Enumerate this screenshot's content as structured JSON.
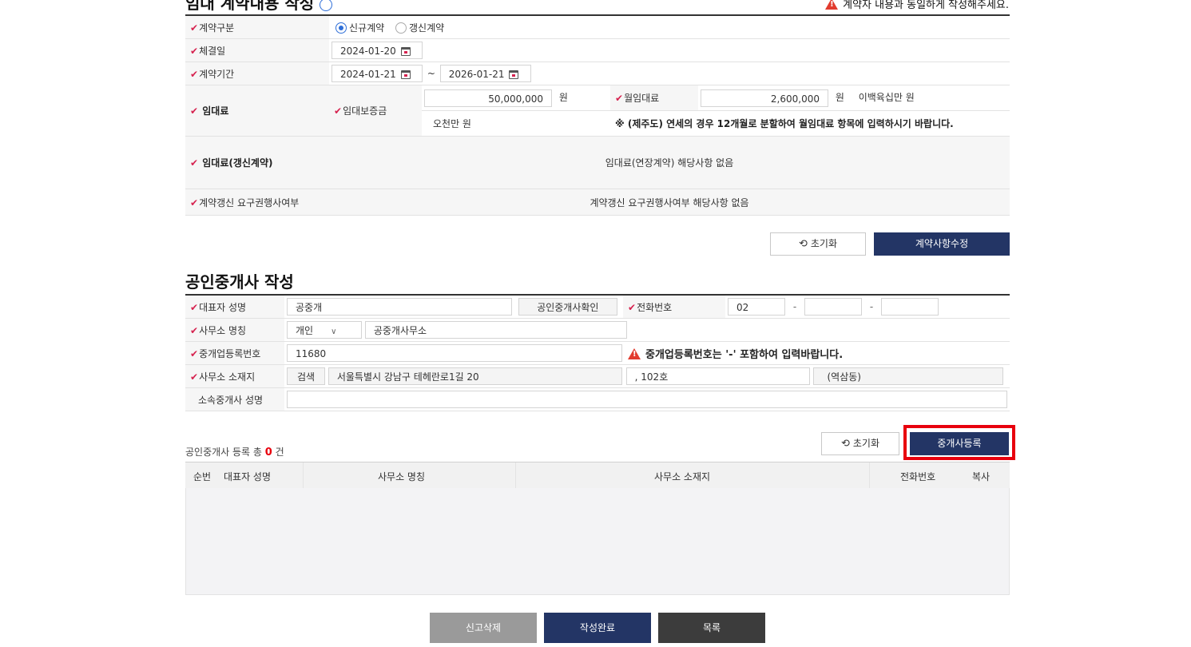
{
  "section1": {
    "title": "임대 계약내용 작성",
    "help_icon": "question-circle-icon",
    "notice": "계약자 내용과 동일하게 작성해주세요.",
    "contract_type": {
      "label": "계약구분",
      "option_new": "신규계약",
      "option_renew": "갱신계약",
      "selected": "신규계약"
    },
    "conclusion_date": {
      "label": "체결일",
      "value": "2024-01-20"
    },
    "contract_period": {
      "label": "계약기간",
      "start": "2024-01-21",
      "tilde": "~",
      "end": "2026-01-21"
    },
    "rent": {
      "label": "임대료",
      "deposit_label": "임대보증금",
      "deposit_value": "50,000,000",
      "deposit_unit": "원",
      "deposit_korean": "오천만 원",
      "monthly_label": "월임대료",
      "monthly_value": "2,600,000",
      "monthly_unit": "원",
      "monthly_korean": "이백육십만 원",
      "jeju_note": "※ (제주도) 연세의 경우 12개월로 분할하여 월임대료 항목에 입력하시기 바랍니다."
    },
    "renew_rent": {
      "label": "임대료(갱신계약)",
      "value": "임대료(연장계약) 해당사항 없음"
    },
    "renew_right": {
      "label": "계약갱신 요구권행사여부",
      "value": "계약갱신 요구권행사여부 해당사항 없음"
    },
    "reset_label": "초기화",
    "modify_label": "계약사항수정"
  },
  "section2": {
    "title": "공인중개사 작성",
    "rep_name": {
      "label": "대표자 성명",
      "value": "공중개",
      "confirm_button": "공인중개사확인"
    },
    "phone": {
      "label": "전화번호",
      "part1": "02",
      "dash": "-",
      "part2": "",
      "part3": ""
    },
    "office_name": {
      "label": "사무소 명칭",
      "type_selected": "개인",
      "value": "공중개사무소"
    },
    "reg_number": {
      "label": "중개업등록번호",
      "value": "11680",
      "warning": "중개업등록번호는 '-' 포함하여 입력바랍니다."
    },
    "office_address": {
      "label": "사무소 소재지",
      "search_button": "검색",
      "address": "서울특별시 강남구 테헤란로1길 20",
      "detail": ", 102호",
      "extra": "(역삼동)"
    },
    "affiliated": {
      "label": "소속중개사 성명",
      "value": ""
    },
    "count_prefix": "공인중개사 등록 총",
    "count_value": "0",
    "count_suffix": "건",
    "reset_label": "초기화",
    "register_label": "중개사등록",
    "grid_headers": [
      "순번",
      "대표자 성명",
      "사무소 명칭",
      "사무소 소재지",
      "전화번호",
      "복사"
    ]
  },
  "footer": {
    "delete_label": "신고삭제",
    "complete_label": "작성완료",
    "list_label": "목록"
  },
  "colors": {
    "navy": "#233565",
    "required": "#d6224f",
    "highlight": "#e8000d",
    "warning": "#e23b2e"
  }
}
